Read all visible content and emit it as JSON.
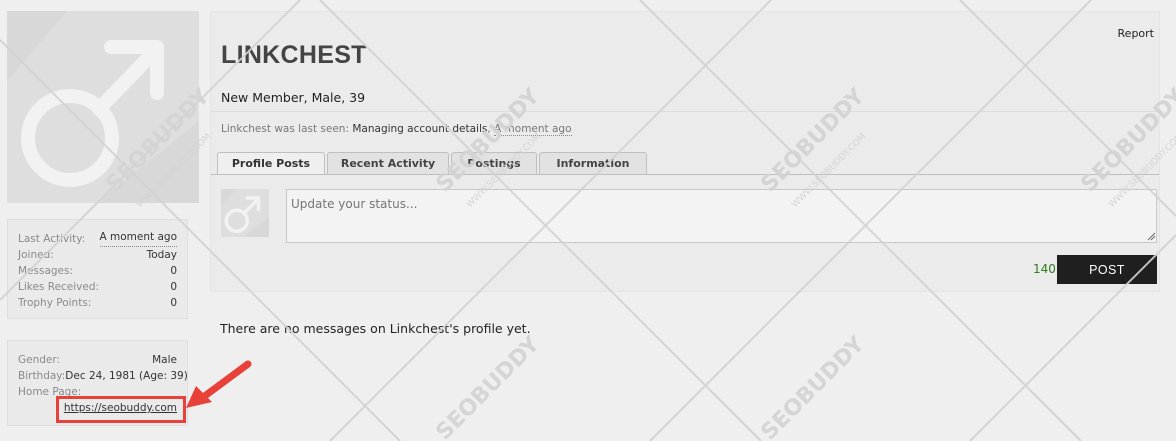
{
  "profile": {
    "username": "LINKCHEST",
    "user_title": "New Member, Male, 39",
    "report_label": "Report",
    "last_seen_prefix": "Linkchest was last seen:",
    "last_seen_activity": "Managing account details",
    "last_seen_separator": ",",
    "last_seen_time": "A moment ago"
  },
  "stats": [
    {
      "key": "Last Activity:",
      "value": "A moment ago"
    },
    {
      "key": "Joined:",
      "value": "Today"
    },
    {
      "key": "Messages:",
      "value": "0"
    },
    {
      "key": "Likes Received:",
      "value": "0"
    },
    {
      "key": "Trophy Points:",
      "value": "0"
    }
  ],
  "info": {
    "gender_label": "Gender:",
    "gender_value": "Male",
    "birthday_label": "Birthday:",
    "birthday_value": "Dec 24, 1981 (Age: 39)",
    "homepage_label": "Home Page:",
    "homepage_value": "https://seobuddy.com"
  },
  "tabs": [
    {
      "label": "Profile Posts",
      "active": true
    },
    {
      "label": "Recent Activity",
      "active": false
    },
    {
      "label": "Postings",
      "active": false
    },
    {
      "label": "Information",
      "active": false
    }
  ],
  "status_box": {
    "placeholder": "Update your status...",
    "char_count": "140",
    "post_label": "POST"
  },
  "empty_message": "There are no messages on Linkchest's profile yet.",
  "watermark": {
    "brand": "SEOBUDDY",
    "domain": "WWW.SEOBUDDY.COM"
  },
  "colors": {
    "accent_green": "#2e7d1e",
    "highlight_red": "#e8413a",
    "post_button": "#1f1f1f"
  }
}
